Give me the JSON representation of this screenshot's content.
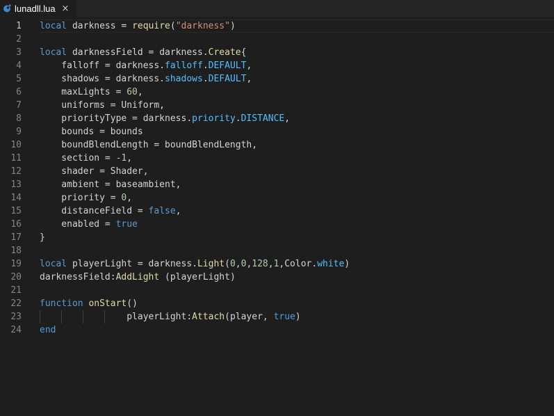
{
  "tab": {
    "filename": "lunadll.lua",
    "close_glyph": "×",
    "icon": "lua-file-icon"
  },
  "colors": {
    "background": "#1e1e1e",
    "keyword": "#569cd6",
    "function": "#dcdcaa",
    "string": "#ce9178",
    "number": "#b5cea8",
    "property": "#4fc1ff",
    "plain": "#d4d4d4",
    "line_number": "#858585"
  },
  "editor": {
    "current_line": 1,
    "lines": [
      {
        "n": "1",
        "tokens": [
          [
            "kw",
            "local"
          ],
          [
            "pl",
            " darkness = "
          ],
          [
            "fn",
            "require"
          ],
          [
            "pl",
            "("
          ],
          [
            "st",
            "\"darkness\""
          ],
          [
            "pl",
            ")"
          ]
        ]
      },
      {
        "n": "2",
        "tokens": []
      },
      {
        "n": "3",
        "tokens": [
          [
            "kw",
            "local"
          ],
          [
            "pl",
            " darknessField = darkness."
          ],
          [
            "fn",
            "Create"
          ],
          [
            "pl",
            "{"
          ]
        ]
      },
      {
        "n": "4",
        "tokens": [
          [
            "pl",
            "    falloff = darkness."
          ],
          [
            "pr",
            "falloff"
          ],
          [
            "pl",
            "."
          ],
          [
            "pr",
            "DEFAULT"
          ],
          [
            "pl",
            ","
          ]
        ]
      },
      {
        "n": "5",
        "tokens": [
          [
            "pl",
            "    shadows = darkness."
          ],
          [
            "pr",
            "shadows"
          ],
          [
            "pl",
            "."
          ],
          [
            "pr",
            "DEFAULT"
          ],
          [
            "pl",
            ","
          ]
        ]
      },
      {
        "n": "6",
        "tokens": [
          [
            "pl",
            "    maxLights = "
          ],
          [
            "nm",
            "60"
          ],
          [
            "pl",
            ","
          ]
        ]
      },
      {
        "n": "7",
        "tokens": [
          [
            "pl",
            "    uniforms = Uniform,"
          ]
        ]
      },
      {
        "n": "8",
        "tokens": [
          [
            "pl",
            "    priorityType = darkness."
          ],
          [
            "pr",
            "priority"
          ],
          [
            "pl",
            "."
          ],
          [
            "pr",
            "DISTANCE"
          ],
          [
            "pl",
            ","
          ]
        ]
      },
      {
        "n": "9",
        "tokens": [
          [
            "pl",
            "    bounds = bounds"
          ]
        ]
      },
      {
        "n": "10",
        "tokens": [
          [
            "pl",
            "    boundBlendLength = boundBlendLength,"
          ]
        ]
      },
      {
        "n": "11",
        "tokens": [
          [
            "pl",
            "    section = "
          ],
          [
            "nm",
            "-1"
          ],
          [
            "pl",
            ","
          ]
        ]
      },
      {
        "n": "12",
        "tokens": [
          [
            "pl",
            "    shader = Shader,"
          ]
        ]
      },
      {
        "n": "13",
        "tokens": [
          [
            "pl",
            "    ambient = baseambient,"
          ]
        ]
      },
      {
        "n": "14",
        "tokens": [
          [
            "pl",
            "    priority = "
          ],
          [
            "nm",
            "0"
          ],
          [
            "pl",
            ","
          ]
        ]
      },
      {
        "n": "15",
        "tokens": [
          [
            "pl",
            "    distanceField = "
          ],
          [
            "kw",
            "false"
          ],
          [
            "pl",
            ","
          ]
        ]
      },
      {
        "n": "16",
        "tokens": [
          [
            "pl",
            "    enabled = "
          ],
          [
            "kw",
            "true"
          ]
        ]
      },
      {
        "n": "17",
        "tokens": [
          [
            "pl",
            "}"
          ]
        ]
      },
      {
        "n": "18",
        "tokens": []
      },
      {
        "n": "19",
        "tokens": [
          [
            "kw",
            "local"
          ],
          [
            "pl",
            " playerLight = darkness."
          ],
          [
            "fn",
            "Light"
          ],
          [
            "pl",
            "("
          ],
          [
            "nm",
            "0"
          ],
          [
            "pl",
            ","
          ],
          [
            "nm",
            "0"
          ],
          [
            "pl",
            ","
          ],
          [
            "nm",
            "128"
          ],
          [
            "pl",
            ","
          ],
          [
            "nm",
            "1"
          ],
          [
            "pl",
            ",Color."
          ],
          [
            "pr",
            "white"
          ],
          [
            "pl",
            ")"
          ]
        ]
      },
      {
        "n": "20",
        "tokens": [
          [
            "pl",
            "darknessField:"
          ],
          [
            "fn",
            "AddLight"
          ],
          [
            "pl",
            " (playerLight)"
          ]
        ]
      },
      {
        "n": "21",
        "tokens": []
      },
      {
        "n": "22",
        "tokens": [
          [
            "kw",
            "function"
          ],
          [
            "pl",
            " "
          ],
          [
            "fn",
            "onStart"
          ],
          [
            "pl",
            "()"
          ]
        ]
      },
      {
        "n": "23",
        "tokens": [
          [
            "pl",
            "                playerLight:"
          ],
          [
            "fn",
            "Attach"
          ],
          [
            "pl",
            "(player, "
          ],
          [
            "kw",
            "true"
          ],
          [
            "pl",
            ")"
          ]
        ],
        "guides": true
      },
      {
        "n": "24",
        "tokens": [
          [
            "kw",
            "end"
          ]
        ]
      }
    ]
  }
}
